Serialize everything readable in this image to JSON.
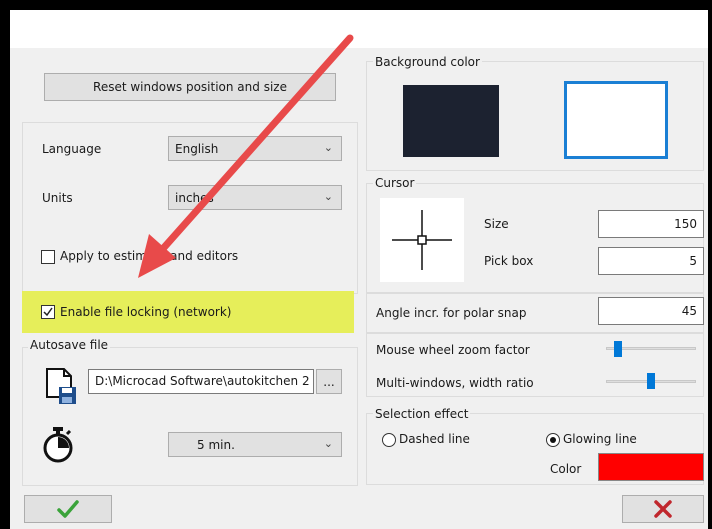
{
  "left": {
    "reset_button": "Reset windows position and size",
    "language": {
      "label": "Language",
      "value": "English"
    },
    "units": {
      "label": "Units",
      "value": "inches"
    },
    "apply_checkbox": {
      "label": "Apply to estimate and editors",
      "checked": false
    },
    "file_locking": {
      "label": "Enable file locking (network)",
      "checked": true,
      "highlight_color": "#e6ee5a"
    },
    "autosave": {
      "title": "Autosave file",
      "path": "D:\\Microcad Software\\autokitchen 2",
      "browse_label": "...",
      "interval": "5 min."
    }
  },
  "right": {
    "background_color": {
      "title": "Background color",
      "dark_swatch": "#1c2230",
      "light_swatch": "#ffffff",
      "selected": "light",
      "selection_border": "#1a7fd4"
    },
    "cursor": {
      "title": "Cursor",
      "size_label": "Size",
      "size_value": "150",
      "pickbox_label": "Pick box",
      "pickbox_value": "5"
    },
    "polar_snap": {
      "label": "Angle incr. for polar snap",
      "value": "45"
    },
    "wheel_zoom": {
      "label": "Mouse wheel zoom factor",
      "level": 0.1
    },
    "multi_windows": {
      "label": "Multi-windows, width ratio",
      "level": 0.5
    },
    "selection_effect": {
      "title": "Selection effect",
      "dashed_label": "Dashed line",
      "glowing_label": "Glowing line",
      "selected": "glowing",
      "color_label": "Color",
      "color": "#ff0000"
    }
  },
  "footer": {
    "ok_icon": "checkmark-icon",
    "ok_color": "#3aa33a",
    "cancel_icon": "x-icon",
    "cancel_color": "#c0272d"
  },
  "annotation": {
    "arrow_color": "#e84a4a"
  }
}
